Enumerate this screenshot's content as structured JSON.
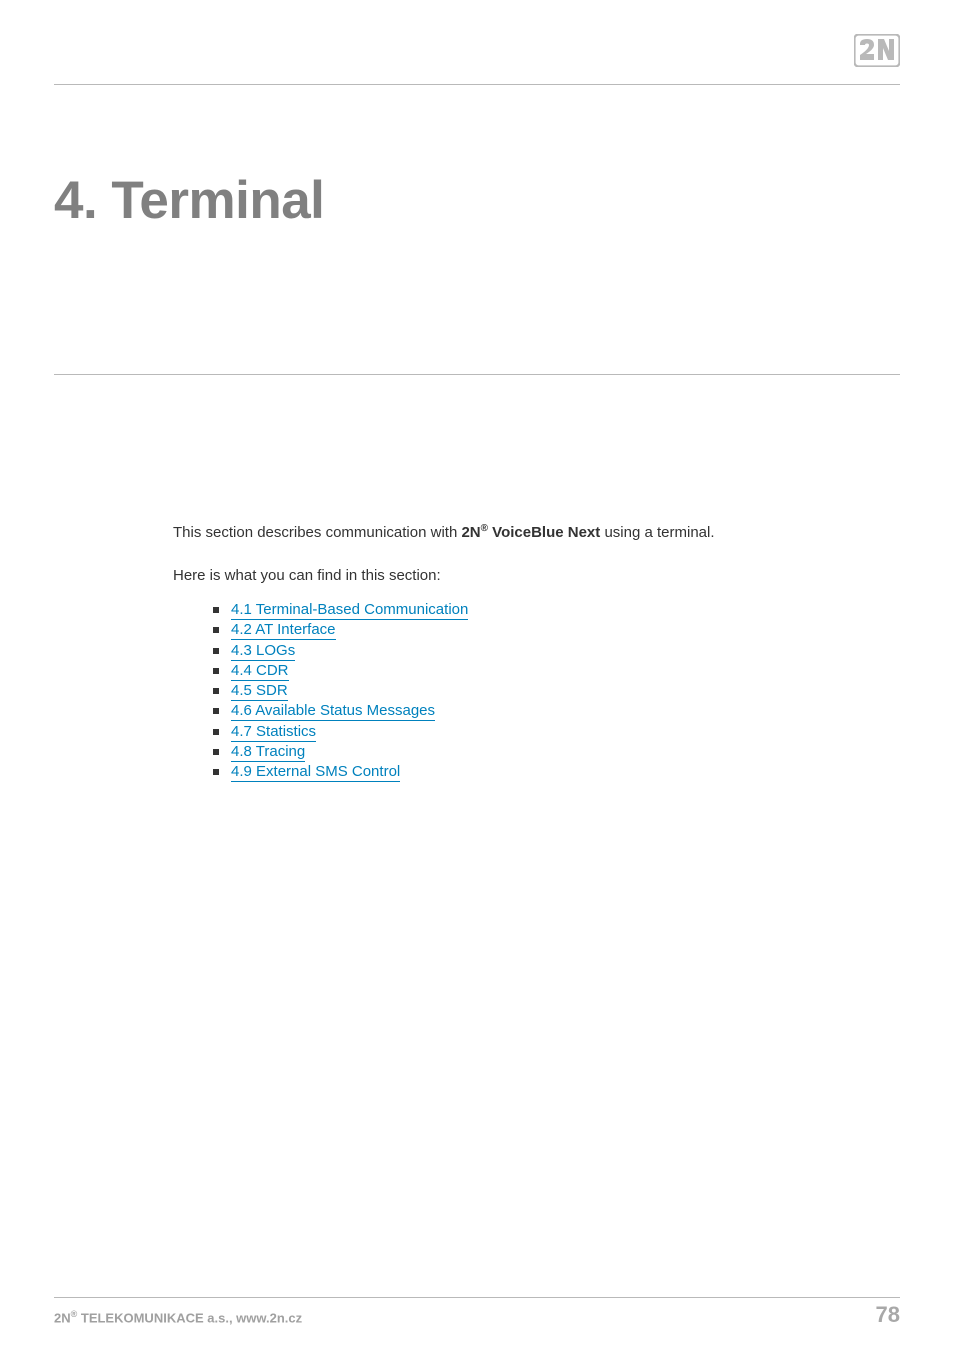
{
  "header": {
    "logo_name": "2N"
  },
  "title": "4. Terminal",
  "intro": {
    "pre": "This section describes communication with ",
    "brand_prefix": "2N",
    "brand_sup": "®",
    "brand_suffix": " VoiceBlue Next",
    "post": " using a terminal."
  },
  "lead": "Here is what you can find in this section:",
  "toc": [
    "4.1 Terminal-Based Communication",
    "4.2 AT Interface",
    "4.3 LOGs",
    "4.4 CDR",
    "4.5 SDR",
    "4.6 Available Status Messages",
    "4.7 Statistics",
    "4.8 Tracing",
    "4.9 External SMS Control"
  ],
  "footer": {
    "left_prefix": "2N",
    "left_sup": "®",
    "left_suffix": " TELEKOMUNIKACE a.s., www.2n.cz",
    "page_number": "78"
  }
}
